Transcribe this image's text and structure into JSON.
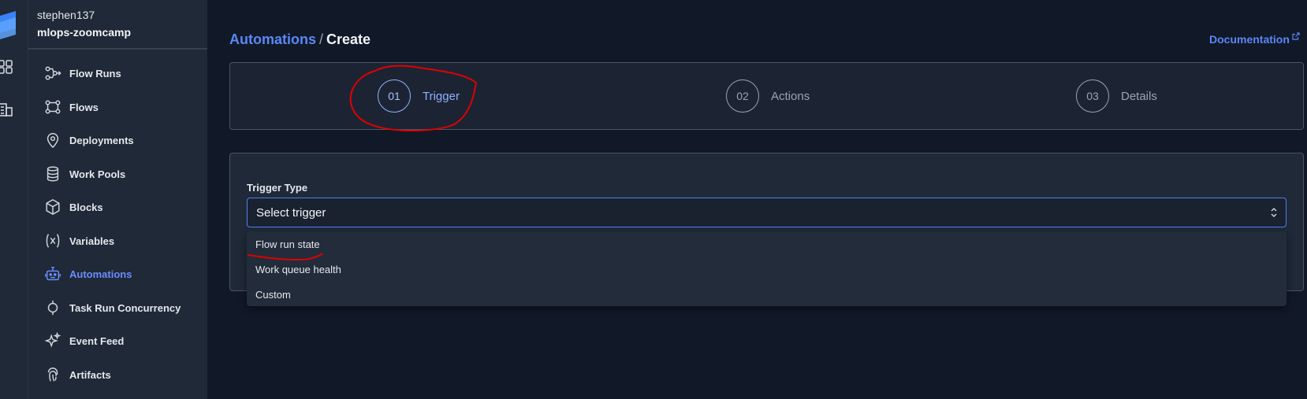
{
  "workspace": {
    "user": "stephen137",
    "name": "mlops-zoomcamp"
  },
  "sidebar": {
    "items": [
      {
        "label": "Flow Runs",
        "icon": "flow-runs-icon"
      },
      {
        "label": "Flows",
        "icon": "flows-icon"
      },
      {
        "label": "Deployments",
        "icon": "map-pin-icon"
      },
      {
        "label": "Work Pools",
        "icon": "database-icon"
      },
      {
        "label": "Blocks",
        "icon": "cube-icon"
      },
      {
        "label": "Variables",
        "icon": "variable-icon"
      },
      {
        "label": "Automations",
        "icon": "robot-icon",
        "active": true
      },
      {
        "label": "Task Run Concurrency",
        "icon": "concurrency-icon"
      },
      {
        "label": "Event Feed",
        "icon": "sparkles-icon"
      },
      {
        "label": "Artifacts",
        "icon": "fingerprint-icon"
      }
    ]
  },
  "breadcrumb": {
    "parent": "Automations",
    "separator": "/",
    "current": "Create"
  },
  "documentation": "Documentation",
  "steps": [
    {
      "number": "01",
      "label": "Trigger",
      "active": true
    },
    {
      "number": "02",
      "label": "Actions",
      "active": false
    },
    {
      "number": "03",
      "label": "Details",
      "active": false
    }
  ],
  "trigger": {
    "label": "Trigger Type",
    "placeholder": "Select trigger",
    "options": [
      "Flow run state",
      "Work queue health",
      "Custom"
    ]
  },
  "colors": {
    "accent": "#5b87f7",
    "background": "#111827",
    "sidebar": "#1f2937",
    "annotation": "#e00000"
  }
}
